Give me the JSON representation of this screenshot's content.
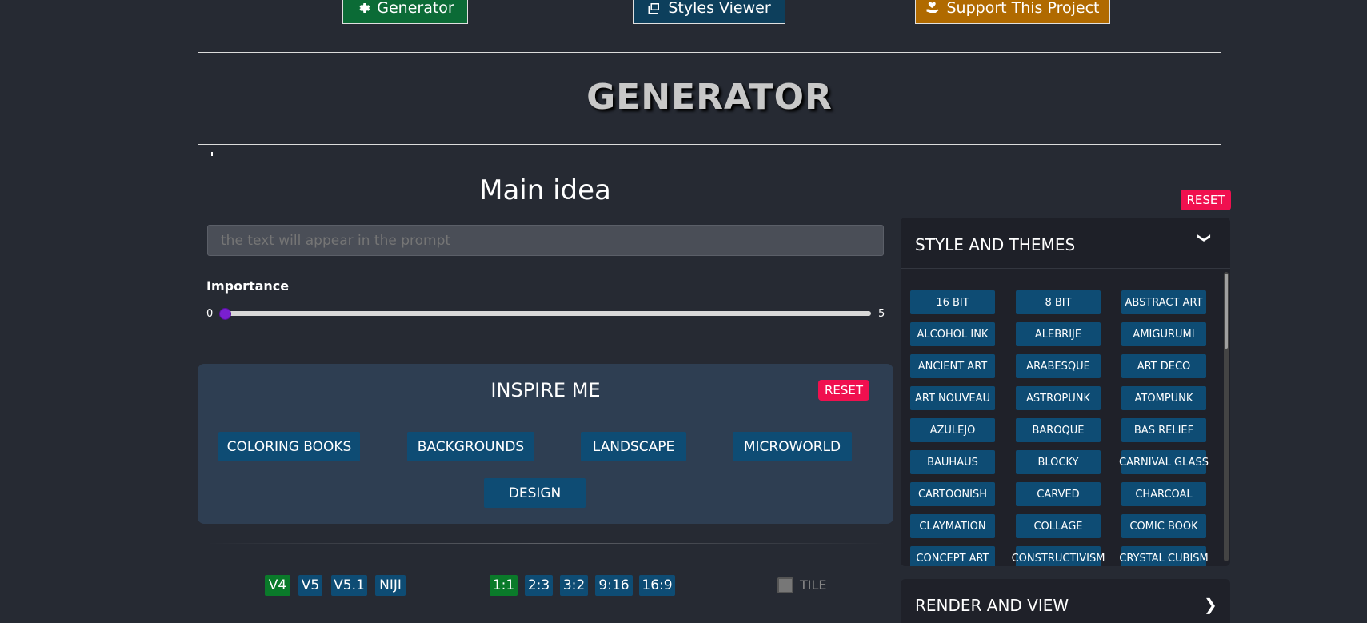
{
  "nav": {
    "generator": "Generator",
    "styles_viewer": "Styles Viewer",
    "support": "Support This Project"
  },
  "page_title": "GENERATOR",
  "main_idea": {
    "title": "Main idea",
    "placeholder": "the text will appear in the prompt",
    "importance_label": "Importance",
    "importance_min": "0",
    "importance_max": "5",
    "importance_value": 0
  },
  "inspire": {
    "title": "INSPIRE ME",
    "reset": "RESET",
    "buttons": [
      "COLORING BOOKS",
      "BACKGROUNDS",
      "LANDSCAPE",
      "MICROWORLD",
      "DESIGN"
    ]
  },
  "versions": [
    "V4",
    "V5",
    "V5.1",
    "NIJI"
  ],
  "aspect_ratios": [
    "1:1",
    "2:3",
    "3:2",
    "9:16",
    "16:9"
  ],
  "tile_label": "TILE",
  "styles": {
    "reset": "RESET",
    "title": "STYLE AND THEMES",
    "items": [
      "16 BIT",
      "8 BIT",
      "ABSTRACT ART",
      "ALCOHOL INK",
      "ALEBRIJE",
      "AMIGURUMI",
      "ANCIENT ART",
      "ARABESQUE",
      "ART DECO",
      "ART NOUVEAU",
      "ASTROPUNK",
      "ATOMPUNK",
      "AZULEJO",
      "BAROQUE",
      "BAS RELIEF",
      "BAUHAUS",
      "BLOCKY",
      "CARNIVAL GLASS",
      "CARTOONISH",
      "CARVED",
      "CHARCOAL",
      "CLAYMATION",
      "COLLAGE",
      "COMIC BOOK",
      "CONCEPT ART",
      "CONSTRUCTIVISM",
      "CRYSTAL CUBISM"
    ]
  },
  "render": {
    "title": "RENDER AND VIEW"
  },
  "colors": {
    "background": "#262a33",
    "button_blue": "#0e4c74",
    "active_green": "#0a7a2a",
    "reset_red": "#f0104f",
    "slider_thumb": "#7a1fd0"
  }
}
